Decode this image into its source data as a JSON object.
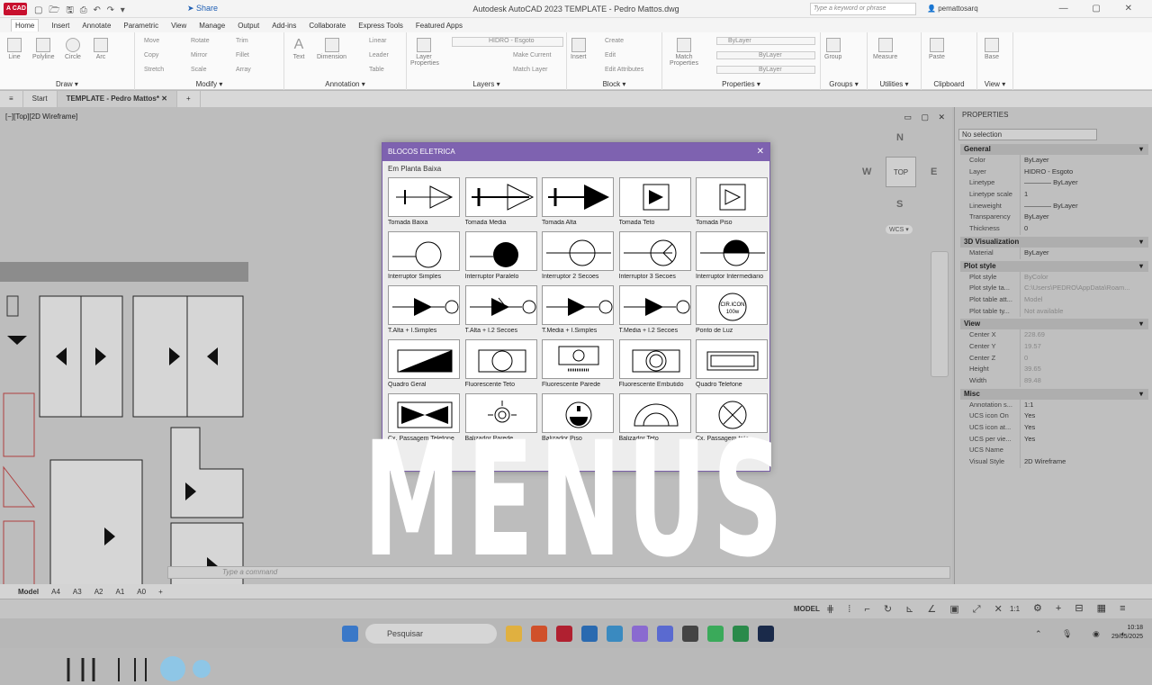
{
  "titlebar": {
    "logo": "A CAD",
    "title": "Autodesk AutoCAD 2023   TEMPLATE - Pedro Mattos.dwg",
    "share": "Share",
    "search_placeholder": "Type a keyword or phrase",
    "user": "pemattosarq"
  },
  "ribbon_tabs": [
    "Home",
    "Insert",
    "Annotate",
    "Parametric",
    "View",
    "Manage",
    "Output",
    "Add-ins",
    "Collaborate",
    "Express Tools",
    "Featured Apps"
  ],
  "ribbon": {
    "draw": {
      "title": "Draw",
      "line": "Line",
      "polyline": "Polyline",
      "circle": "Circle",
      "arc": "Arc"
    },
    "modify": {
      "title": "Modify",
      "move": "Move",
      "rotate": "Rotate",
      "trim": "Trim",
      "copy": "Copy",
      "mirror": "Mirror",
      "fillet": "Fillet",
      "stretch": "Stretch",
      "scale": "Scale",
      "array": "Array"
    },
    "annotation": {
      "title": "Annotation",
      "text": "Text",
      "dimension": "Dimension",
      "linear": "Linear",
      "leader": "Leader",
      "table": "Table"
    },
    "layers": {
      "title": "Layers",
      "layer_properties": "Layer Properties",
      "current_layer": "HIDRO - Esgoto",
      "make_current": "Make Current",
      "match_layer": "Match Layer"
    },
    "block": {
      "title": "Block",
      "insert": "Insert",
      "create": "Create",
      "edit": "Edit",
      "edit_attributes": "Edit Attributes"
    },
    "properties": {
      "title": "Properties",
      "match": "Match Properties",
      "color": "ByLayer",
      "linetype": "ByLayer",
      "lineweight": "ByLayer"
    },
    "groups": {
      "title": "Groups",
      "group": "Group"
    },
    "utilities": {
      "title": "Utilities",
      "measure": "Measure"
    },
    "clipboard": {
      "title": "Clipboard",
      "paste": "Paste"
    },
    "view": {
      "title": "View",
      "base": "Base"
    }
  },
  "file_tabs": {
    "start": "Start",
    "current": "TEMPLATE - Pedro Mattos*"
  },
  "viewport": {
    "label": "[−][Top][2D Wireframe]",
    "cube": {
      "n": "N",
      "s": "S",
      "e": "E",
      "w": "W",
      "top": "TOP"
    },
    "wcs": "WCS"
  },
  "command_placeholder": "Type a command",
  "layout_tabs": [
    "Model",
    "A4",
    "A3",
    "A2",
    "A1",
    "A0"
  ],
  "status": {
    "model": "MODEL",
    "scale": "1:1"
  },
  "taskbar": {
    "search": "Pesquisar",
    "time": "10:18",
    "date": "29/05/2025"
  },
  "properties_panel": {
    "title": "PROPERTIES",
    "selection": "No selection",
    "sections": [
      {
        "name": "General",
        "rows": [
          [
            "Color",
            "ByLayer"
          ],
          [
            "Layer",
            "HIDRO - Esgoto"
          ],
          [
            "Linetype",
            "———— ByLayer"
          ],
          [
            "Linetype scale",
            "1"
          ],
          [
            "Lineweight",
            "———— ByLayer"
          ],
          [
            "Transparency",
            "ByLayer"
          ],
          [
            "Thickness",
            "0"
          ]
        ]
      },
      {
        "name": "3D Visualization",
        "rows": [
          [
            "Material",
            "ByLayer"
          ]
        ]
      },
      {
        "name": "Plot style",
        "rows": [
          [
            "Plot style",
            "ByColor"
          ],
          [
            "Plot style ta...",
            "C:\\Users\\PEDRO\\AppData\\Roam..."
          ],
          [
            "Plot table att...",
            "Model"
          ],
          [
            "Plot table ty...",
            "Not available"
          ]
        ]
      },
      {
        "name": "View",
        "rows": [
          [
            "Center X",
            "228.69"
          ],
          [
            "Center Y",
            "19.57"
          ],
          [
            "Center Z",
            "0"
          ],
          [
            "Height",
            "39.65"
          ],
          [
            "Width",
            "89.48"
          ]
        ]
      },
      {
        "name": "Misc",
        "rows": [
          [
            "Annotation s...",
            "1:1"
          ],
          [
            "UCS icon On",
            "Yes"
          ],
          [
            "UCS icon at...",
            "Yes"
          ],
          [
            "UCS per vie...",
            "Yes"
          ],
          [
            "UCS Name",
            ""
          ],
          [
            "Visual Style",
            "2D Wireframe"
          ]
        ]
      }
    ]
  },
  "dialog": {
    "title": "BLOCOS ELETRICA",
    "subtitle": "Em Planta Baixa",
    "blocks": [
      [
        "Tomada Baixa",
        "Tomada Media",
        "Tomada Alta",
        "Tomada Teto",
        "Tomada Piso"
      ],
      [
        "Interruptor Simples",
        "Interruptor Paralelo",
        "Interruptor 2 Secoes",
        "Interruptor 3 Secoes",
        "Interruptor Intermediario"
      ],
      [
        "T.Alta + I.Simples",
        "T.Alta + I.2 Secoes",
        "T.Media + I.Simples",
        "T.Media + I.2 Secoes",
        "Ponto de Luz"
      ],
      [
        "Quadro Geral",
        "Fluorescente Teto",
        "Fluorescente Parede",
        "Fluorescente Embutido",
        "Quadro Telefone"
      ],
      [
        "Cx. Passagem Telefone",
        "Balizador Parede",
        "Balizador Piso",
        "Balizador Teto",
        "Cx. Passagem teto"
      ]
    ],
    "ponto_luz_text": [
      "CIR.ICON",
      "100w"
    ]
  },
  "overlay_text": "MENUS"
}
